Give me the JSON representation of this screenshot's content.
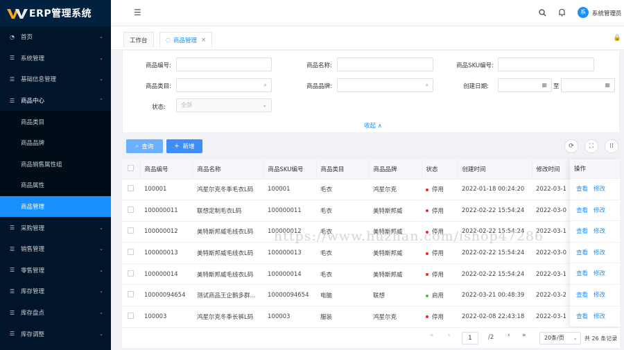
{
  "app": {
    "title": "ERP管理系统"
  },
  "colors": {
    "sidebar": "#001529",
    "accent": "#1890ff",
    "stop": "#f5222d",
    "enable": "#52c41a"
  },
  "sidebar": {
    "items": [
      {
        "label": "首页",
        "icon": "dashboard-icon"
      },
      {
        "label": "系统管理",
        "icon": "menu-icon"
      },
      {
        "label": "基础信息管理",
        "icon": "menu-icon"
      },
      {
        "label": "商品中心",
        "icon": "menu-icon",
        "open": true
      },
      {
        "label": "采购管理",
        "icon": "menu-icon"
      },
      {
        "label": "销售管理",
        "icon": "menu-icon"
      },
      {
        "label": "零售管理",
        "icon": "menu-icon"
      },
      {
        "label": "库存管理",
        "icon": "menu-icon"
      },
      {
        "label": "库存盘点",
        "icon": "menu-icon"
      },
      {
        "label": "库存调整",
        "icon": "menu-icon"
      }
    ],
    "subitems": [
      "商品类目",
      "商品品牌",
      "商品销售属性组",
      "商品属性",
      "商品管理"
    ]
  },
  "header": {
    "user_initial": "系",
    "user_name": "系统管理员"
  },
  "tabs": [
    {
      "label": "工作台"
    },
    {
      "label": "商品管理"
    }
  ],
  "filters": {
    "code_label": "商品编号:",
    "name_label": "商品名称:",
    "sku_label": "商品SKU编号:",
    "category_label": "商品类目:",
    "brand_label": "商品品牌:",
    "date_label": "创建日期:",
    "date_sep": "至",
    "status_label": "状态:",
    "status_value": "全部",
    "collapse": "收起"
  },
  "toolbar": {
    "query": "查询",
    "add": "新增"
  },
  "table": {
    "headers": [
      "商品编号",
      "商品名称",
      "商品SKU编号",
      "商品类目",
      "商品品牌",
      "状态",
      "创建时间",
      "修改时间"
    ],
    "ops_header": "操作",
    "view": "查看",
    "edit": "修改",
    "rows": [
      {
        "code": "100001",
        "name": "鸿星尔克冬季毛衣L码",
        "sku": "100001",
        "category": "毛衣",
        "brand": "鸿星尔克",
        "status": "停用",
        "created": "2022-01-18 00:24:20",
        "modified": "2022-03-1"
      },
      {
        "code": "100000011",
        "name": "联想定制毛衣L码",
        "sku": "100000011",
        "category": "毛衣",
        "brand": "美特斯邦威",
        "status": "停用",
        "created": "2022-02-22 15:54:24",
        "modified": "2022-03-0"
      },
      {
        "code": "100000012",
        "name": "美特斯邦威毛线衣L码",
        "sku": "100000012",
        "category": "毛衣",
        "brand": "美特斯邦威",
        "status": "停用",
        "created": "2022-02-22 15:54:24",
        "modified": "2022-03-1"
      },
      {
        "code": "100000013",
        "name": "美特斯邦威毛线衣L码",
        "sku": "100000013",
        "category": "毛衣",
        "brand": "美特斯邦威",
        "status": "停用",
        "created": "2022-02-22 15:54:24",
        "modified": "2022-03-0"
      },
      {
        "code": "100000014",
        "name": "美特斯邦威毛线衣L码",
        "sku": "100000014",
        "category": "毛衣",
        "brand": "美特斯邦威",
        "status": "停用",
        "created": "2022-02-22 15:54:24",
        "modified": "2022-03-1"
      },
      {
        "code": "10000094654",
        "name": "测试商品王企鹅多群...",
        "sku": "10000094654",
        "category": "电脑",
        "brand": "联想",
        "status": "启用",
        "created": "2022-03-21 00:48:39",
        "modified": "2022-03-2"
      },
      {
        "code": "100003",
        "name": "鸿星尔克冬季长裤L码",
        "sku": "100003",
        "category": "服装",
        "brand": "鸿星尔克",
        "status": "停用",
        "created": "2022-02-08 22:43:18",
        "modified": "2022-03-1"
      }
    ]
  },
  "pagination": {
    "current": "1",
    "total_pages": "/2",
    "page_size": "20条/页",
    "total": "共 26 条记录"
  },
  "watermark": "https://www.huzhan.com/ishop47286"
}
